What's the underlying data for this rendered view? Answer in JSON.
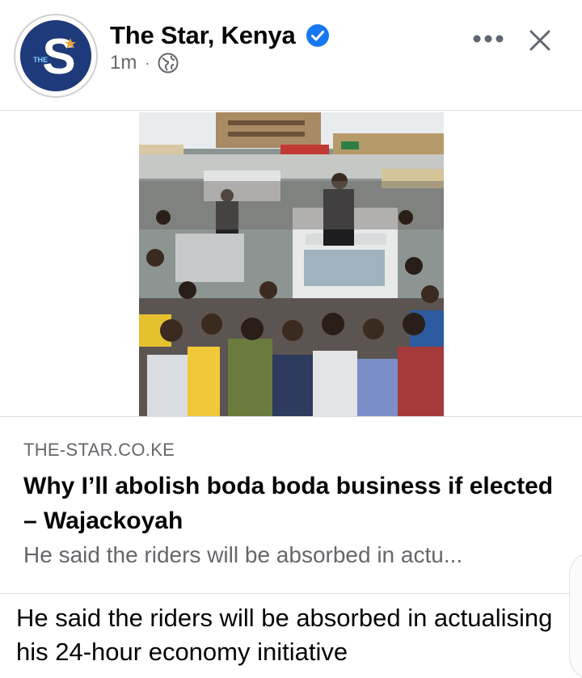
{
  "post": {
    "page_name": "The Star, Kenya",
    "avatar_letter": "S",
    "avatar_tag": "THE",
    "time": "1m",
    "separator": "·",
    "caption": "He said the riders will be absorbed in actualising his 24-hour economy initiative"
  },
  "link_preview": {
    "domain": "THE-STAR.CO.KE",
    "headline": "Why I’ll abolish boda boda business if elected – Wajackoyah",
    "description": "He said the riders will be absorbed in actu..."
  },
  "icons": {
    "verified": "verified-badge-icon",
    "audience": "globe-icon",
    "more": "more-options-icon",
    "close": "close-icon"
  },
  "colors": {
    "verified_blue": "#1877f2",
    "avatar_navy": "#1e3a7a",
    "secondary_text": "#65676b"
  }
}
